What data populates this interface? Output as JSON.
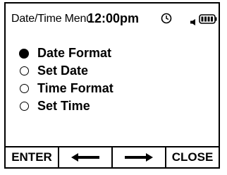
{
  "header": {
    "menu_name": "Date/Time Menu",
    "time": "12:00pm",
    "icons": [
      "clock-icon",
      "speaker-icon",
      "battery-icon"
    ]
  },
  "menu": {
    "selected_index": 0,
    "items": [
      {
        "label": "Date Format"
      },
      {
        "label": "Set Date"
      },
      {
        "label": "Time Format"
      },
      {
        "label": "Set Time"
      }
    ]
  },
  "softkeys": {
    "enter": "ENTER",
    "left_icon": "left-arrow-icon",
    "right_icon": "right-arrow-icon",
    "close": "CLOSE"
  }
}
